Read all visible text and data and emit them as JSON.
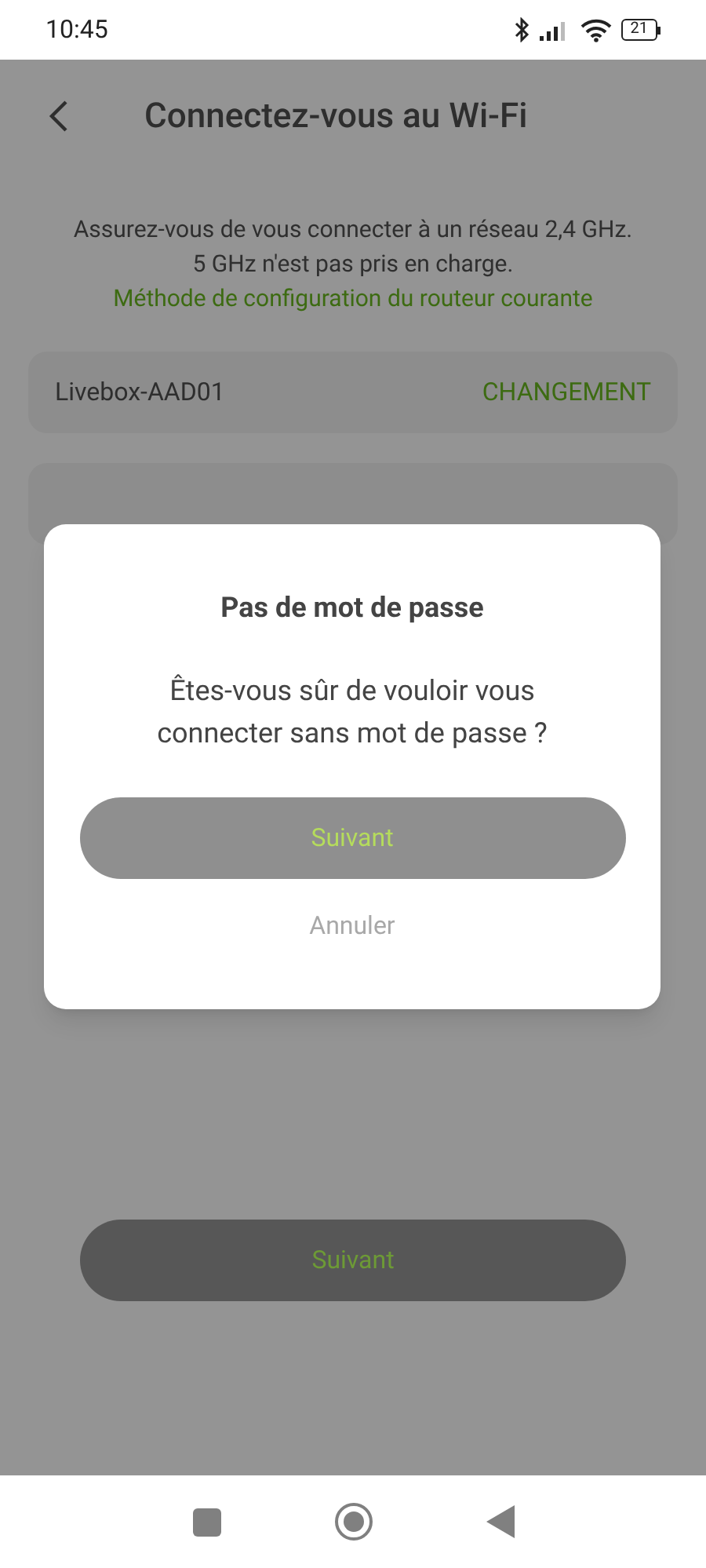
{
  "status_bar": {
    "time": "10:45",
    "battery": "21"
  },
  "header": {
    "title": "Connectez-vous au Wi-Fi"
  },
  "info": {
    "lines": [
      "Assurez-vous de vous connecter à un réseau 2,4 GHz.",
      "5 GHz n'est pas pris en charge."
    ],
    "link": "Méthode de configuration du routeur courante"
  },
  "network": {
    "name": "Livebox-AAD01",
    "action": "CHANGEMENT"
  },
  "next_button": {
    "label": "Suivant"
  },
  "dialog": {
    "title": "Pas de mot de passe",
    "message": "Êtes-vous sûr de vouloir vous connecter sans mot de passe ?",
    "confirm": "Suivant",
    "cancel": "Annuler"
  }
}
